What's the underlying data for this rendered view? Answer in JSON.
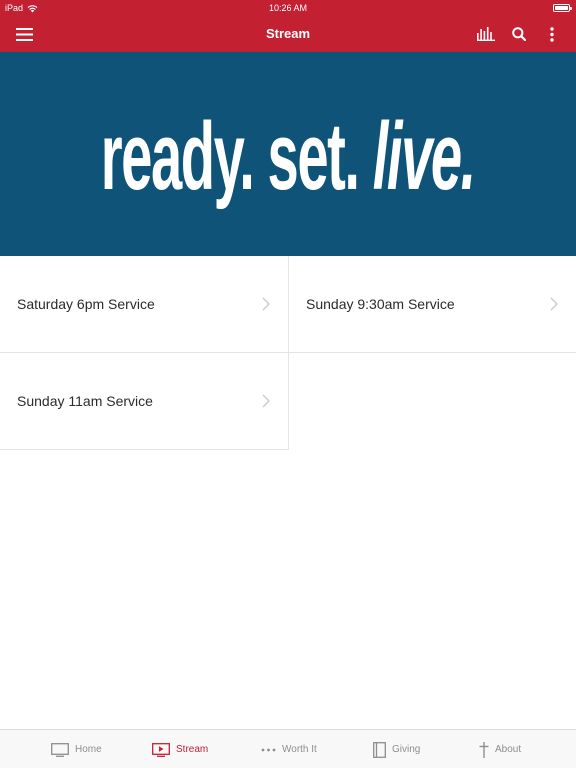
{
  "status_bar": {
    "device": "iPad",
    "time": "10:26 AM"
  },
  "nav_bar": {
    "title": "Stream",
    "icons": [
      "menu-icon",
      "stats-icon",
      "search-icon",
      "more-vertical-icon"
    ]
  },
  "hero": {
    "text_part1": "ready. set.",
    "text_part2": "live."
  },
  "services": [
    {
      "label": "Saturday 6pm Service"
    },
    {
      "label": "Sunday 9:30am Service"
    },
    {
      "label": "Sunday 11am Service"
    }
  ],
  "tabs": [
    {
      "label": "Home",
      "icon": "tv-icon",
      "active": false
    },
    {
      "label": "Stream",
      "icon": "play-screen-icon",
      "active": true
    },
    {
      "label": "Worth It",
      "icon": "dots-icon",
      "active": false
    },
    {
      "label": "Giving",
      "icon": "book-icon",
      "active": false
    },
    {
      "label": "About",
      "icon": "cross-icon",
      "active": false
    }
  ],
  "colors": {
    "brand_red": "#c32032",
    "hero_blue": "#0f5378",
    "tab_inactive": "#8e8e8e"
  }
}
